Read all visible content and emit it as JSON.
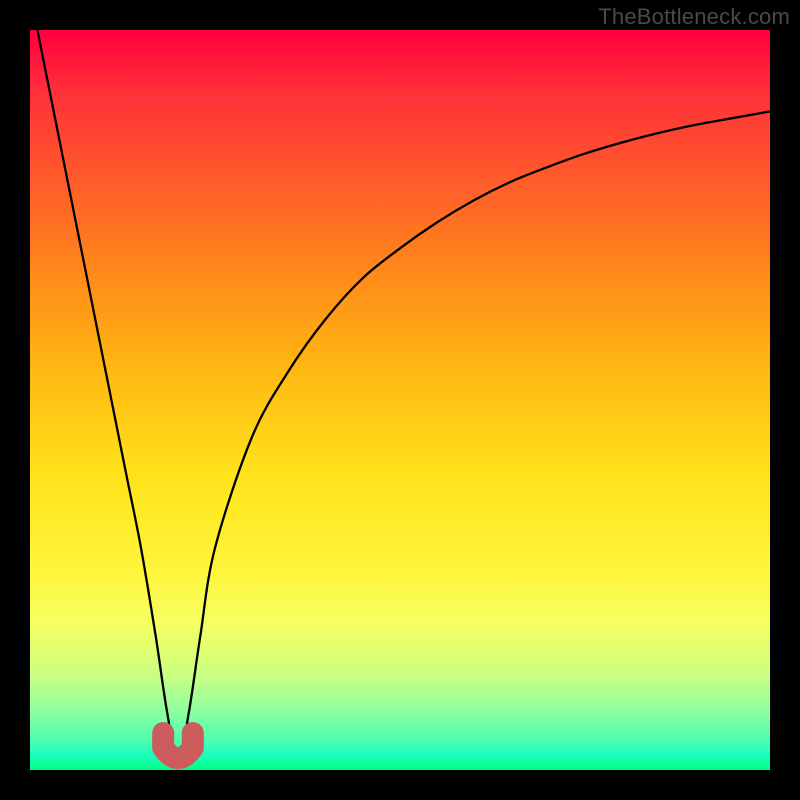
{
  "watermark": {
    "text": "TheBottleneck.com"
  },
  "chart_data": {
    "type": "line",
    "title": "",
    "xlabel": "",
    "ylabel": "",
    "xlim": [
      0,
      100
    ],
    "ylim": [
      0,
      100
    ],
    "grid": false,
    "legend": false,
    "series": [
      {
        "name": "bottleneck-curve",
        "x": [
          1,
          3,
          5,
          7,
          9,
          11,
          13,
          15,
          17,
          18.5,
          20,
          21.5,
          23,
          25,
          30,
          35,
          40,
          45,
          50,
          55,
          60,
          65,
          70,
          75,
          80,
          85,
          90,
          95,
          100
        ],
        "y": [
          100,
          90,
          80,
          70,
          60,
          50,
          40,
          30,
          18,
          8,
          1,
          8,
          18,
          30,
          45,
          54,
          61,
          66.5,
          70.5,
          74,
          77,
          79.5,
          81.5,
          83.3,
          84.8,
          86.1,
          87.2,
          88.1,
          89
        ]
      }
    ],
    "marker": {
      "x": 20,
      "y": 1,
      "width": 4,
      "height": 4,
      "color": "#cc5c5c"
    },
    "background_gradient": {
      "stops": [
        {
          "pos": 0,
          "color": "#ff0040"
        },
        {
          "pos": 60,
          "color": "#ffe21a"
        },
        {
          "pos": 100,
          "color": "#00ff80"
        }
      ]
    }
  }
}
